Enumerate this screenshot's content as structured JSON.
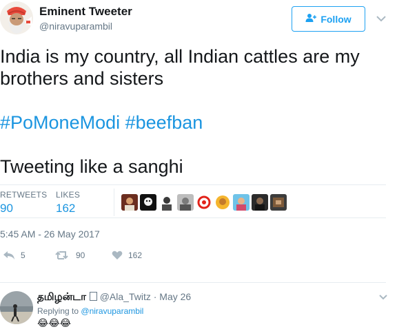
{
  "author": {
    "name": "Eminent Tweeter",
    "handle": "@niravuparambil",
    "avatar_icon": "bearded-man-turban-avatar"
  },
  "follow_button": {
    "label": "Follow",
    "icon": "add-user-icon",
    "color": "#1da1f2"
  },
  "tweet": {
    "line1": "India is my country, all Indian cattles are my",
    "line2": "brothers and sisters",
    "hashtags": [
      "#PoMoneModi",
      "#beefban"
    ],
    "closing": "Tweeting like a sanghi"
  },
  "stats": {
    "retweets_label": "RETWEETS",
    "retweets_value": "90",
    "likes_label": "LIKES",
    "likes_value": "162"
  },
  "timestamp": "5:45 AM - 26 May 2017",
  "actions": {
    "reply_count": "5",
    "retweet_count": "90",
    "like_count": "162"
  },
  "reply": {
    "name": "தமிழன்டா",
    "handle": "@Ala_Twitz",
    "date": "May 26",
    "replying_prefix": "Replying to",
    "replying_to": "@niravuparambil",
    "body": "😂😂😂"
  },
  "colors": {
    "link": "#1b95e0",
    "muted": "#657786",
    "divider": "#e6ecf0"
  }
}
